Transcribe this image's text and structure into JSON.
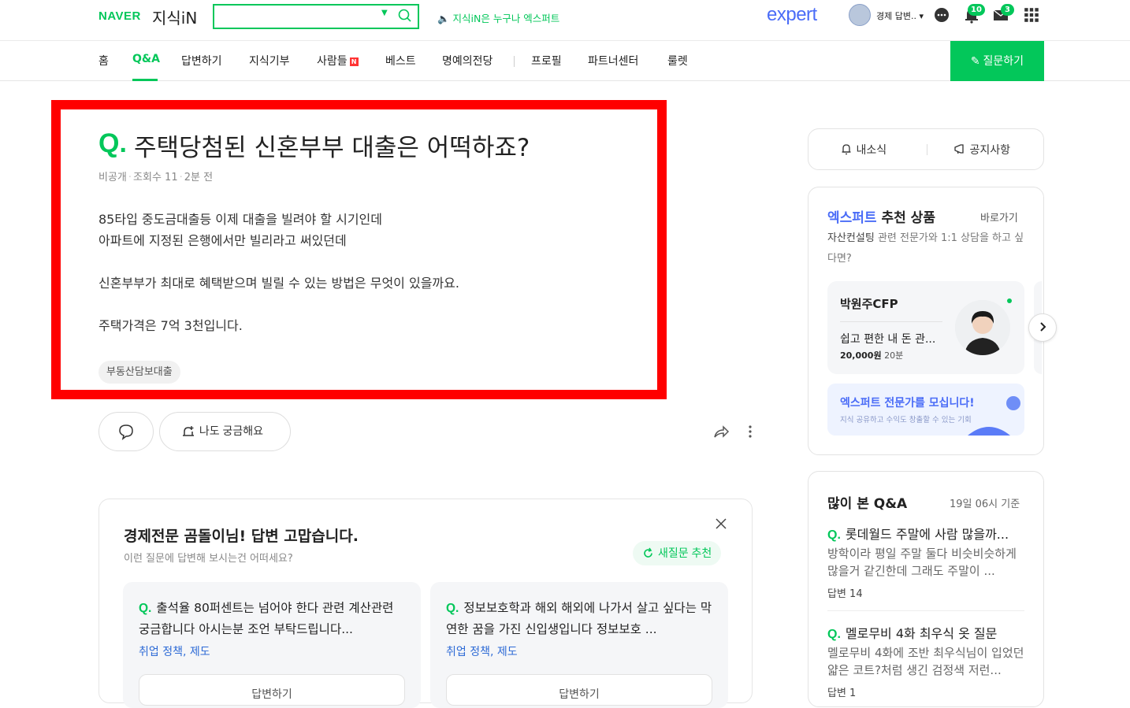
{
  "header": {
    "brand": "NAVER",
    "service": "지식iN",
    "search_placeholder": "",
    "tagline": "🔈 지식iN은 누구나 엑스퍼트",
    "expert_logo": "expert",
    "user_name": "경제 답변.. ▾",
    "notif_count": "10",
    "mail_count": "3"
  },
  "nav": {
    "items": [
      "홈",
      "Q&A",
      "답변하기",
      "지식기부",
      "사람들",
      "베스트",
      "명예의전당",
      "프로필",
      "파트너센터",
      "룰렛"
    ],
    "n_badge": "N",
    "ask_button": "✎ 질문하기"
  },
  "question": {
    "q_mark": "Q.",
    "title": "주택당첨된 신혼부부 대출은 어떡하죠?",
    "author": "비공개",
    "views": "조회수 11",
    "time": "2분 전",
    "body": "85타입 중도금대출등 이제 대출을 빌려야 할 시기인데\n아파트에 지정된 은행에서만 빌리라고 써있던데\n\n신혼부부가 최대로 혜택받으며 빌릴 수 있는 방법은 무엇이 있을까요.\n\n주택가격은 7억 3천입니다.",
    "tag": "부동산담보대출"
  },
  "actions": {
    "curious": "나도 궁금해요"
  },
  "recommend": {
    "title": "경제전문 곰돌이님! 답변 고맙습니다.",
    "subtitle": "이런 질문에 답변해 보시는건 어떠세요?",
    "refresh": "새질문 추천",
    "cards": [
      {
        "q": "Q.",
        "title": "출석율 80퍼센트는 넘어야 한다 관련 계산관련 궁금합니다 아시는분 조언 부탁드립니다...",
        "category": "취업 정책, 제도",
        "button": "답변하기"
      },
      {
        "q": "Q.",
        "title": "정보보호학과 해외 해외에 나가서 살고 싶다는 막연한 꿈을 가진 신입생입니다 정보보호 ...",
        "category": "취업 정책, 제도",
        "button": "답변하기"
      }
    ]
  },
  "sidebar": {
    "my_news": "내소식",
    "notice": "공지사항",
    "expert": {
      "head_blue": "엑스퍼트",
      "head_rest": "추천 상품",
      "link": "바로가기",
      "sub_bold": "자산컨설팅",
      "sub_rest": " 관련 전문가와 1:1 상담을 하고 싶다면?",
      "card_name": "박원주CFP",
      "card_desc": "쉽고 편한 내 돈 관...",
      "card_price": "20,000원",
      "card_duration": "20분",
      "recruit_title": "엑스퍼트 전문가를 모십니다!",
      "recruit_sub": "지식 공유하고 수익도 창출할 수 있는 기회"
    },
    "popular": {
      "head": "많이 본 Q&A",
      "time": "19일 06시 기준",
      "items": [
        {
          "q": "Q.",
          "title": "롯데월드 주말에 사람 많을까...",
          "body": "방학이라 평일 주말 둘다 비슷비슷하게 많을거 같긴한데 그래도 주말이 ...",
          "answers": "답변 14"
        },
        {
          "q": "Q.",
          "title": "멜로무비 4화 최우식 옷 질문",
          "body": "멜로무비 4화에 조반 최우식님이 입었던 얇은 코트?처럼 생긴 검정색 저런...",
          "answers": "답변 1"
        }
      ]
    }
  },
  "colors": {
    "brand_green": "#03c75a",
    "expert_blue": "#4a6cf7",
    "highlight_red": "#ff0000"
  }
}
